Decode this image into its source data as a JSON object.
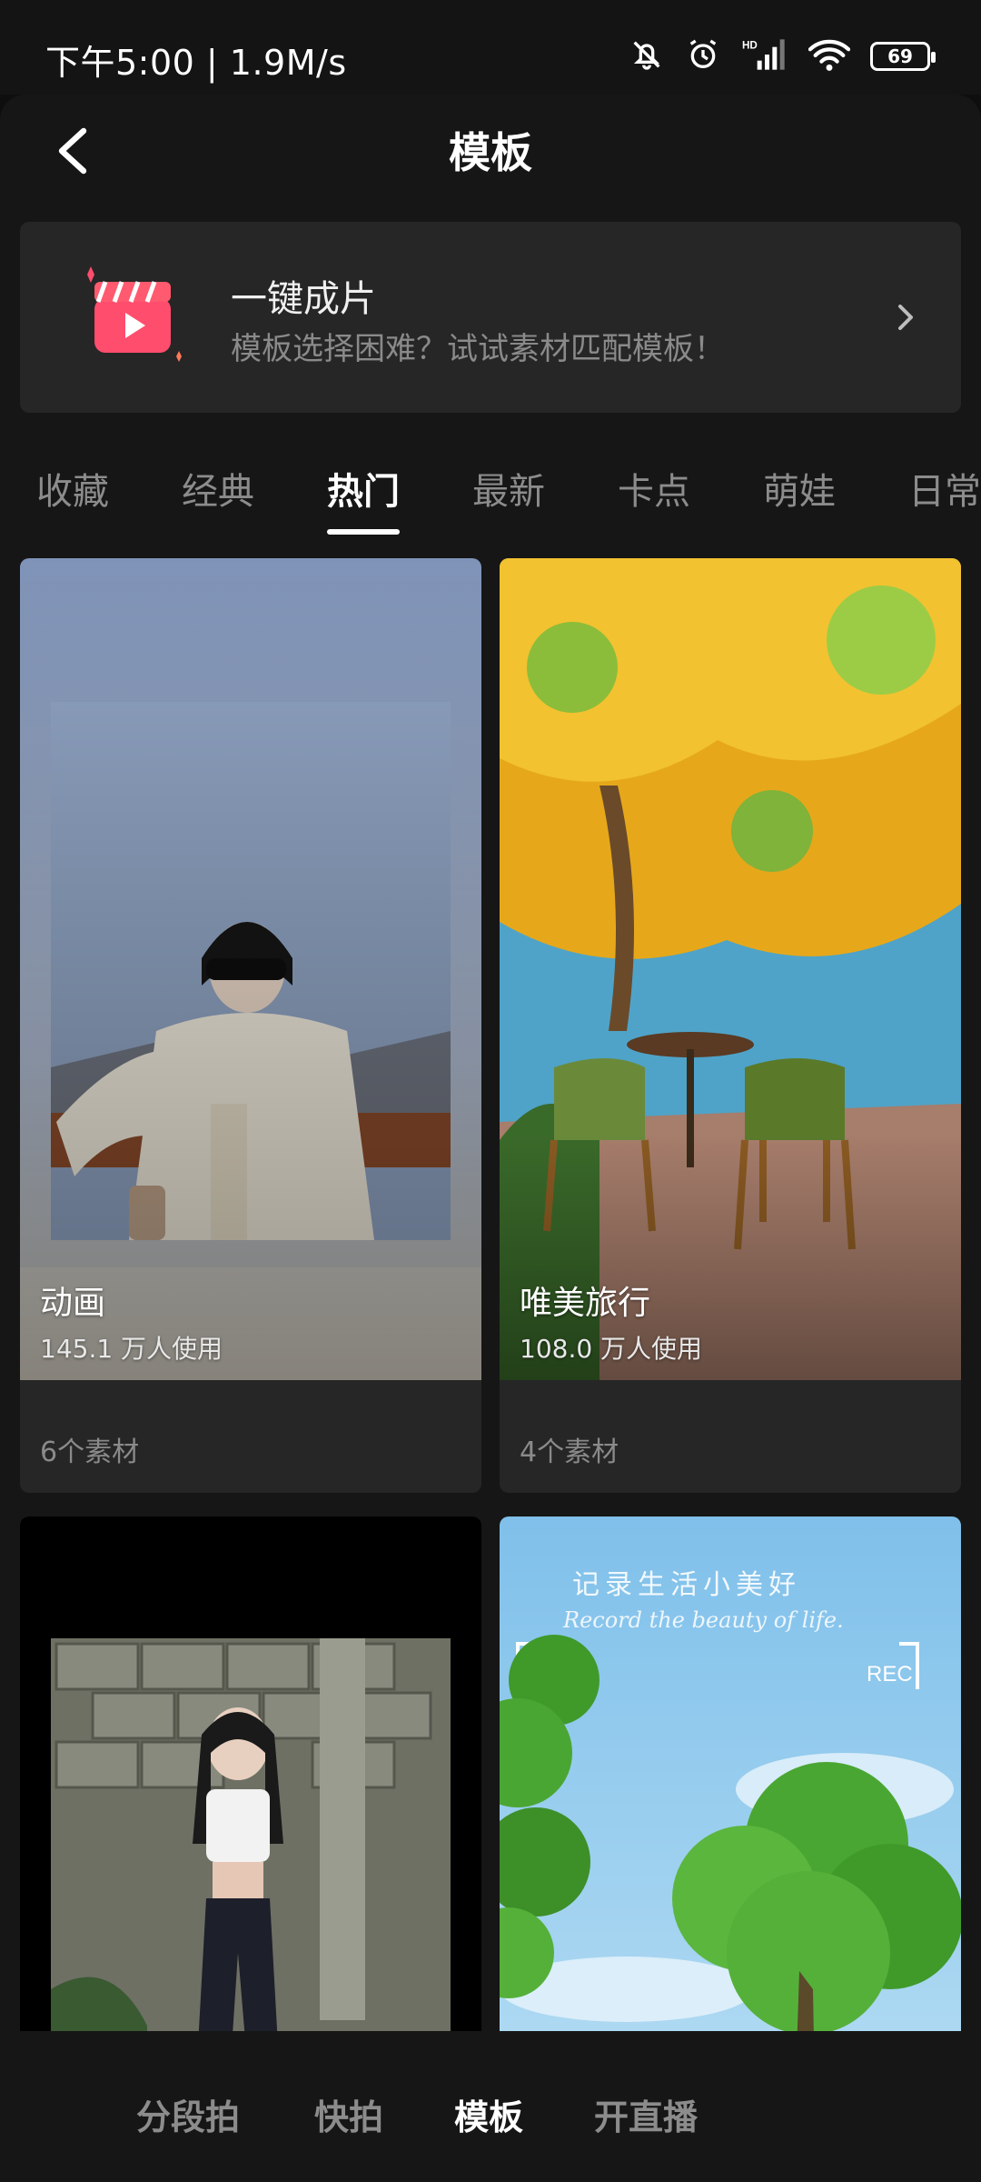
{
  "status_bar": {
    "time_speed": "下午5:00 | 1.9M/s",
    "battery": "69"
  },
  "header": {
    "title": "模板"
  },
  "promo": {
    "title": "一键成片",
    "subtitle": "模板选择困难？试试素材匹配模板！"
  },
  "tabs": [
    {
      "label": "收藏"
    },
    {
      "label": "经典"
    },
    {
      "label": "热门",
      "active": true
    },
    {
      "label": "最新"
    },
    {
      "label": "卡点"
    },
    {
      "label": "萌娃"
    },
    {
      "label": "日常"
    }
  ],
  "cards": [
    {
      "title": "动画",
      "usage": "145.1 万人使用",
      "footer": "6个素材"
    },
    {
      "title": "唯美旅行",
      "usage": "108.0 万人使用",
      "footer": "4个素材"
    },
    {
      "title": "",
      "usage": "",
      "footer": ""
    },
    {
      "title": "",
      "usage": "",
      "footer": "",
      "overlay_text": "记录生活小美好",
      "overlay_subtext": "Record the beauty of life.",
      "rec_label": "REC"
    }
  ],
  "bottom_nav": [
    {
      "label": "分段拍"
    },
    {
      "label": "快拍"
    },
    {
      "label": "模板",
      "active": true
    },
    {
      "label": "开直播"
    }
  ]
}
